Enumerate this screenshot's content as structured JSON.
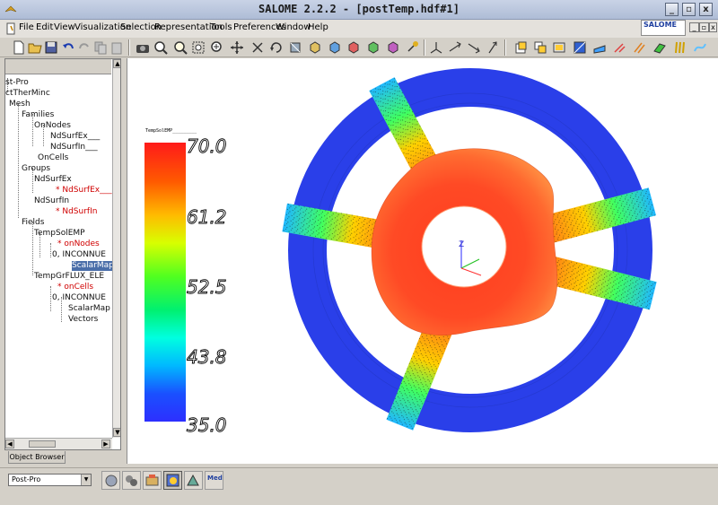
{
  "window": {
    "title": "SALOME 2.2.2 - [postTemp.hdf#1]",
    "controls": [
      "_",
      "▫",
      "x"
    ]
  },
  "menubar": {
    "items": [
      "File",
      "Edit",
      "View",
      "Visualization",
      "Selection",
      "Representation",
      "Tools",
      "Preferences",
      "Window",
      "Help"
    ],
    "logo_text": "SALOME",
    "mdi_controls": [
      "_",
      "▫",
      "x"
    ]
  },
  "browser": {
    "tab_label": "Object Browser",
    "tree": [
      {
        "label": "st-Pro"
      },
      {
        "label": "ctTherMinc"
      },
      {
        "label": "Mesh"
      },
      {
        "label": "Families"
      },
      {
        "label": "OnNodes"
      },
      {
        "label": "NdSurfEx___"
      },
      {
        "label": "NdSurfIn___"
      },
      {
        "label": "OnCells"
      },
      {
        "label": "Groups"
      },
      {
        "label": "NdSurfEx"
      },
      {
        "label": "* NdSurfEx___",
        "red": true
      },
      {
        "label": "NdSurfIn"
      },
      {
        "label": "* NdSurfIn",
        "red": true
      },
      {
        "label": "Fields"
      },
      {
        "label": "TempSolEMP"
      },
      {
        "label": "* onNodes",
        "red": true
      },
      {
        "label": "0, INCONNUE"
      },
      {
        "label": "ScalarMap",
        "selected": true
      },
      {
        "label": "TempGrFLUX_ELE"
      },
      {
        "label": "* onCells",
        "red": true
      },
      {
        "label": "0, INCONNUE"
      },
      {
        "label": "ScalarMap"
      },
      {
        "label": "Vectors"
      }
    ]
  },
  "viewer": {
    "scalar_bar": {
      "labels": [
        "70.0",
        "61.2",
        "52.5",
        "43.8",
        "35.0"
      ],
      "title": "TempSolEMP_________"
    },
    "axis_label": "Z"
  },
  "statusbar": {
    "module_selector": "Post-Pro",
    "modules": [
      "geometry-module-icon",
      "mesh-module-icon",
      "supervisor-module-icon",
      "post-pro-module-icon",
      "visu-module-icon",
      "med-module-icon"
    ],
    "med_label": "Med"
  },
  "colors": {
    "accent": "#4a6ea9",
    "selection": "#4a6ea9",
    "tree_red": "#d00000",
    "ring_blue": "#2a3fe9"
  }
}
